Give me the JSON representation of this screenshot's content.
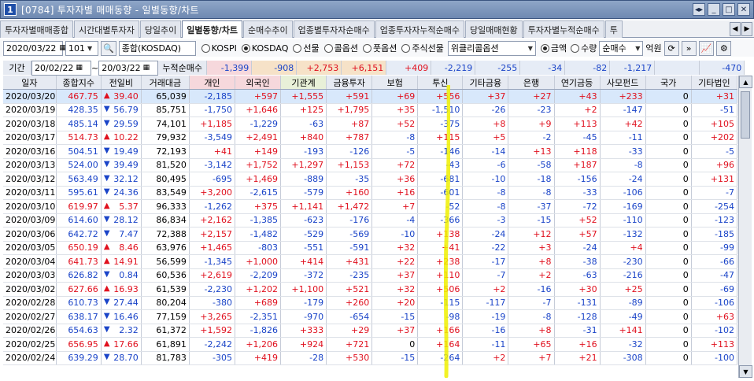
{
  "window": {
    "number": "1",
    "title": "[0784]  투자자별 매매동향 - 일별동향/차트",
    "controls": [
      "◀▶",
      "▭",
      "🗗",
      "✕"
    ]
  },
  "tabs": [
    "투자자별매매종합",
    "시간대별투자자",
    "당일추이",
    "일별동향/차트",
    "순매수추이",
    "업종별투자자순매수",
    "업종투자자누적순매수",
    "당일매매현황",
    "투자자별누적순매수",
    "투"
  ],
  "active_tab_index": 3,
  "controls": {
    "date": "2020/03/22",
    "code": "101",
    "market": "종합(KOSDAQ)",
    "radios": [
      {
        "label": "KOSPI",
        "on": false
      },
      {
        "label": "KOSDAQ",
        "on": true
      },
      {
        "label": "선물",
        "on": false
      },
      {
        "label": "콜옵션",
        "on": false
      },
      {
        "label": "풋옵션",
        "on": false
      },
      {
        "label": "주식선물",
        "on": false
      }
    ],
    "option_select": "위클리콜옵션",
    "amount_radios": [
      {
        "label": "금액",
        "on": true
      },
      {
        "label": "수량",
        "on": false
      }
    ],
    "net_select": "순매수",
    "unit": "억원"
  },
  "period": {
    "label": "기간",
    "from": "20/02/22",
    "to": "20/03/22",
    "cum_label": "누적순매수",
    "values": [
      "-1,399",
      "-908",
      "+2,753",
      "+6,151",
      "+409",
      "-2,219",
      "-255",
      "-34",
      "-82",
      "-1,217",
      "",
      "-470"
    ]
  },
  "headers": [
    "일자",
    "종합지수",
    "전일비",
    "거래대금",
    "개인",
    "외국인",
    "기관계",
    "금융투자",
    "보험",
    "투신",
    "기타금융",
    "은행",
    "연기금등",
    "사모펀드",
    "국가",
    "기타법인"
  ],
  "rows": [
    [
      "2020/03/20",
      "467.75",
      "▲",
      "39.40",
      "65,039",
      "-2,185",
      "+597",
      "+1,555",
      "+591",
      "+69",
      "+556",
      "+37",
      "+27",
      "+43",
      "+233",
      "0",
      "+31"
    ],
    [
      "2020/03/19",
      "428.35",
      "▼",
      "56.79",
      "85,751",
      "-1,750",
      "+1,646",
      "+125",
      "+1,795",
      "+35",
      "-1,510",
      "-26",
      "-23",
      "+2",
      "-147",
      "0",
      "-51"
    ],
    [
      "2020/03/18",
      "485.14",
      "▼",
      "29.59",
      "74,101",
      "+1,185",
      "-1,229",
      "-63",
      "+87",
      "+52",
      "-375",
      "+8",
      "+9",
      "+113",
      "+42",
      "0",
      "+105"
    ],
    [
      "2020/03/17",
      "514.73",
      "▲",
      "10.22",
      "79,932",
      "-3,549",
      "+2,491",
      "+840",
      "+787",
      "-8",
      "+115",
      "+5",
      "-2",
      "-45",
      "-11",
      "0",
      "+202"
    ],
    [
      "2020/03/16",
      "504.51",
      "▼",
      "19.49",
      "72,193",
      "+41",
      "+149",
      "-193",
      "-126",
      "-5",
      "-146",
      "-14",
      "+13",
      "+118",
      "-33",
      "0",
      "-5"
    ],
    [
      "2020/03/13",
      "524.00",
      "▼",
      "39.49",
      "81,520",
      "-3,142",
      "+1,752",
      "+1,297",
      "+1,153",
      "+72",
      "-43",
      "-6",
      "-58",
      "+187",
      "-8",
      "0",
      "+96"
    ],
    [
      "2020/03/12",
      "563.49",
      "▼",
      "32.12",
      "80,495",
      "-695",
      "+1,469",
      "-889",
      "-35",
      "+36",
      "-681",
      "-10",
      "-18",
      "-156",
      "-24",
      "0",
      "+131"
    ],
    [
      "2020/03/11",
      "595.61",
      "▼",
      "24.36",
      "83,549",
      "+3,200",
      "-2,615",
      "-579",
      "+160",
      "+16",
      "-601",
      "-8",
      "-8",
      "-33",
      "-106",
      "0",
      "-7"
    ],
    [
      "2020/03/10",
      "619.97",
      "▲",
      "5.37",
      "96,333",
      "-1,262",
      "+375",
      "+1,141",
      "+1,472",
      "+7",
      "-52",
      "-8",
      "-37",
      "-72",
      "-169",
      "0",
      "-254"
    ],
    [
      "2020/03/09",
      "614.60",
      "▼",
      "28.12",
      "86,834",
      "+2,162",
      "-1,385",
      "-623",
      "-176",
      "-4",
      "-366",
      "-3",
      "-15",
      "+52",
      "-110",
      "0",
      "-123"
    ],
    [
      "2020/03/06",
      "642.72",
      "▼",
      "7.47",
      "72,388",
      "+2,157",
      "-1,482",
      "-529",
      "-569",
      "-10",
      "+138",
      "-24",
      "+12",
      "+57",
      "-132",
      "0",
      "-185"
    ],
    [
      "2020/03/05",
      "650.19",
      "▲",
      "8.46",
      "63,976",
      "+1,465",
      "-803",
      "-551",
      "-591",
      "+32",
      "+41",
      "-22",
      "+3",
      "-24",
      "+4",
      "0",
      "-99"
    ],
    [
      "2020/03/04",
      "641.73",
      "▲",
      "14.91",
      "56,599",
      "-1,345",
      "+1,000",
      "+414",
      "+431",
      "+22",
      "+238",
      "-17",
      "+8",
      "-38",
      "-230",
      "0",
      "-66"
    ],
    [
      "2020/03/03",
      "626.82",
      "▼",
      "0.84",
      "60,536",
      "+2,619",
      "-2,209",
      "-372",
      "-235",
      "+37",
      "+110",
      "-7",
      "+2",
      "-63",
      "-216",
      "0",
      "-47"
    ],
    [
      "2020/03/02",
      "627.66",
      "▲",
      "16.93",
      "61,539",
      "-2,230",
      "+1,202",
      "+1,100",
      "+521",
      "+32",
      "+506",
      "+2",
      "-16",
      "+30",
      "+25",
      "0",
      "-69"
    ],
    [
      "2020/02/28",
      "610.73",
      "▼",
      "27.44",
      "80,204",
      "-380",
      "+689",
      "-179",
      "+260",
      "+20",
      "-115",
      "-117",
      "-7",
      "-131",
      "-89",
      "0",
      "-106"
    ],
    [
      "2020/02/27",
      "638.17",
      "▼",
      "16.46",
      "77,159",
      "+3,265",
      "-2,351",
      "-970",
      "-654",
      "-15",
      "-98",
      "-19",
      "-8",
      "-128",
      "-49",
      "0",
      "+63"
    ],
    [
      "2020/02/26",
      "654.63",
      "▼",
      "2.32",
      "61,372",
      "+1,592",
      "-1,826",
      "+333",
      "+29",
      "+37",
      "+166",
      "-16",
      "+8",
      "-31",
      "+141",
      "0",
      "-102"
    ],
    [
      "2020/02/25",
      "656.95",
      "▲",
      "17.66",
      "61,891",
      "-2,242",
      "+1,206",
      "+924",
      "+721",
      "0",
      "+164",
      "-11",
      "+65",
      "+16",
      "-32",
      "0",
      "+113"
    ],
    [
      "2020/02/24",
      "639.29",
      "▼",
      "28.70",
      "81,783",
      "-305",
      "+419",
      "-28",
      "+530",
      "-15",
      "-264",
      "+2",
      "+7",
      "+21",
      "-308",
      "0",
      "-100"
    ]
  ],
  "colors": {
    "up": "#e0101e",
    "down": "#1a44c8",
    "highlight": "#f0f000",
    "selected_row": "#d8e8fb",
    "individual_hdr": "#f6d8dc",
    "foreign_hdr": "#f6d8dc",
    "inst_hdr": "#e8f0d8"
  }
}
